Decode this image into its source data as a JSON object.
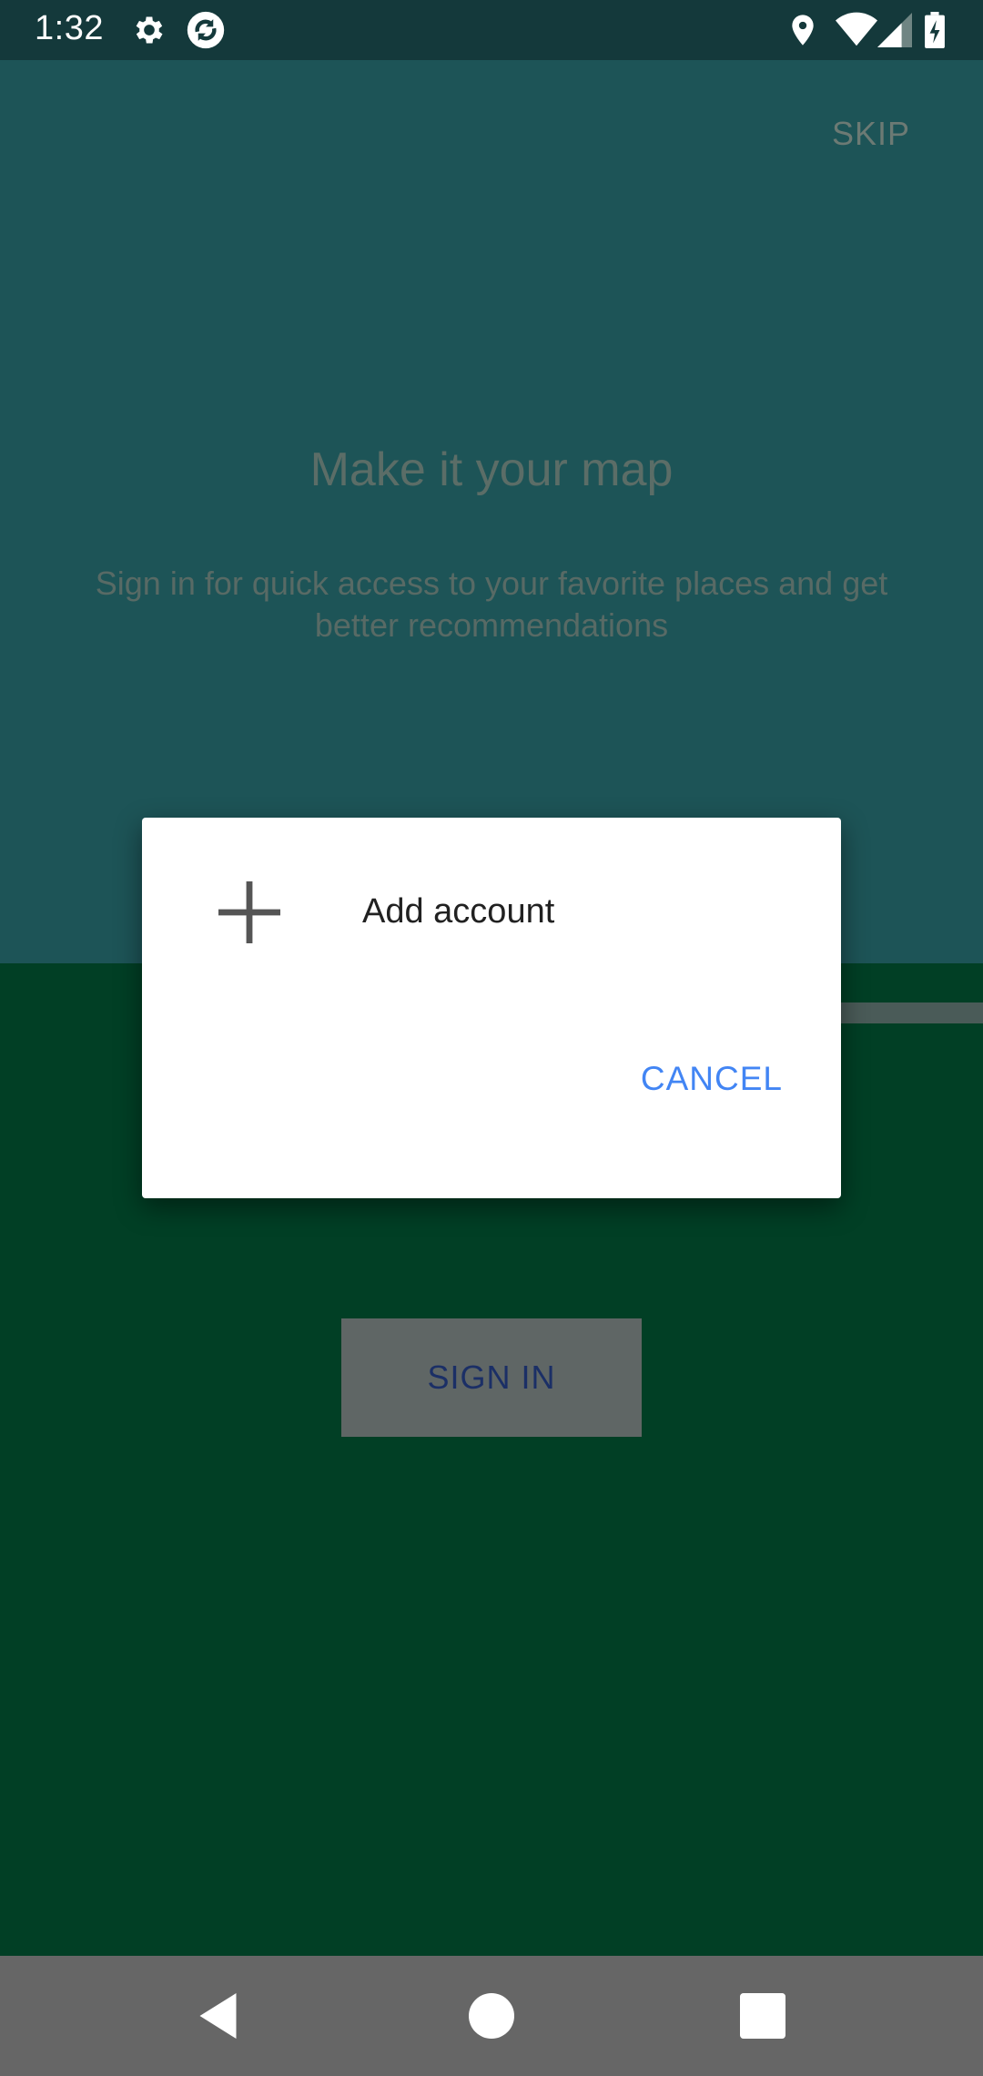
{
  "status_bar": {
    "time": "1:32",
    "icons": [
      "gear-icon",
      "sync-icon",
      "location-icon",
      "wifi-icon",
      "signal-icon",
      "battery-icon"
    ]
  },
  "onboarding": {
    "skip_label": "SKIP",
    "title": "Make it your map",
    "subtitle": "Sign in for quick access to your favorite places and get better recommendations",
    "sign_in_label": "SIGN IN"
  },
  "dialog": {
    "add_account_label": "Add account",
    "cancel_label": "CANCEL"
  },
  "nav_bar": {
    "icons": [
      "back-icon",
      "home-icon",
      "recents-icon"
    ]
  },
  "colors": {
    "status_bar": "#14393b",
    "top_area": "#1d5457",
    "bottom_area": "#013f25",
    "accent": "#4285f4",
    "nav_bar": "#666666"
  }
}
